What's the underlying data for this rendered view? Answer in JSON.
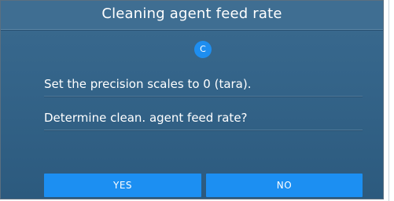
{
  "dialog": {
    "title": "Cleaning agent feed rate",
    "badge": "C",
    "lines": [
      "Set the precision scales to 0 (tara).",
      "Determine clean. agent feed rate?"
    ],
    "buttons": {
      "yes": "YES",
      "no": "NO"
    }
  },
  "colors": {
    "background": "#346489",
    "accent": "#1c8ff2"
  }
}
